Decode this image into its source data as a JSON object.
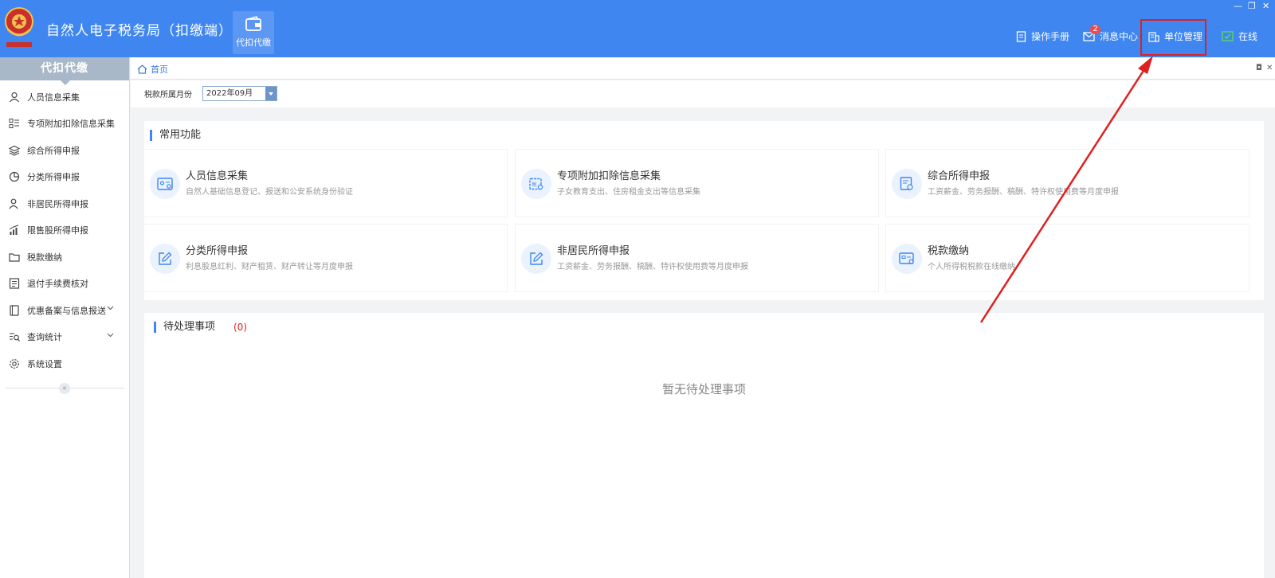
{
  "app": {
    "title": "自然人电子税务局（扣缴端）",
    "module_label": "代扣代缴"
  },
  "header_links": {
    "manual": "操作手册",
    "messages": "消息中心",
    "messages_badge": "2",
    "unit_mgmt": "单位管理",
    "online": "在线"
  },
  "window_controls": {
    "minimize": "—",
    "restore": "❐",
    "close": "✕"
  },
  "sidebar": {
    "title": "代扣代缴",
    "items": [
      {
        "label": "人员信息采集",
        "icon": "person-icon"
      },
      {
        "label": "专项附加扣除信息采集",
        "icon": "list-icon"
      },
      {
        "label": "综合所得申报",
        "icon": "layers-icon"
      },
      {
        "label": "分类所得申报",
        "icon": "pie-icon"
      },
      {
        "label": "非居民所得申报",
        "icon": "person-outline-icon"
      },
      {
        "label": "限售股所得申报",
        "icon": "bar-chart-icon"
      },
      {
        "label": "税款缴纳",
        "icon": "folder-icon"
      },
      {
        "label": "退付手续费核对",
        "icon": "document-icon"
      },
      {
        "label": "优惠备案与信息报送",
        "icon": "book-icon"
      },
      {
        "label": "查询统计",
        "icon": "search-list-icon"
      },
      {
        "label": "系统设置",
        "icon": "gear-icon"
      }
    ],
    "collapse": "«"
  },
  "tabs": {
    "home": "首页"
  },
  "filter": {
    "label": "税款所属月份",
    "month": "2022年09月"
  },
  "common": {
    "title": "常用功能",
    "cards": [
      {
        "title": "人员信息采集",
        "desc": "自然人基础信息登记、报送和公安系统身份验证"
      },
      {
        "title": "专项附加扣除信息采集",
        "desc": "子女教育支出、住房租金支出等信息采集"
      },
      {
        "title": "综合所得申报",
        "desc": "工资薪金、劳务报酬、稿酬、特许权使用费等月度申报"
      },
      {
        "title": "分类所得申报",
        "desc": "利息股息红利、财产租赁、财产转让等月度申报"
      },
      {
        "title": "非居民所得申报",
        "desc": "工资薪金、劳务报酬、稿酬、特许权使用费等月度申报"
      },
      {
        "title": "税款缴纳",
        "desc": "个人所得税税款在线缴纳"
      }
    ]
  },
  "pending": {
    "title": "待处理事项",
    "count": "(0)",
    "empty": "暂无待处理事项"
  },
  "colors": {
    "header": "#3f86f1",
    "accent": "#3f86f1",
    "annotation": "#e02020",
    "badge": "#f04b4b"
  }
}
